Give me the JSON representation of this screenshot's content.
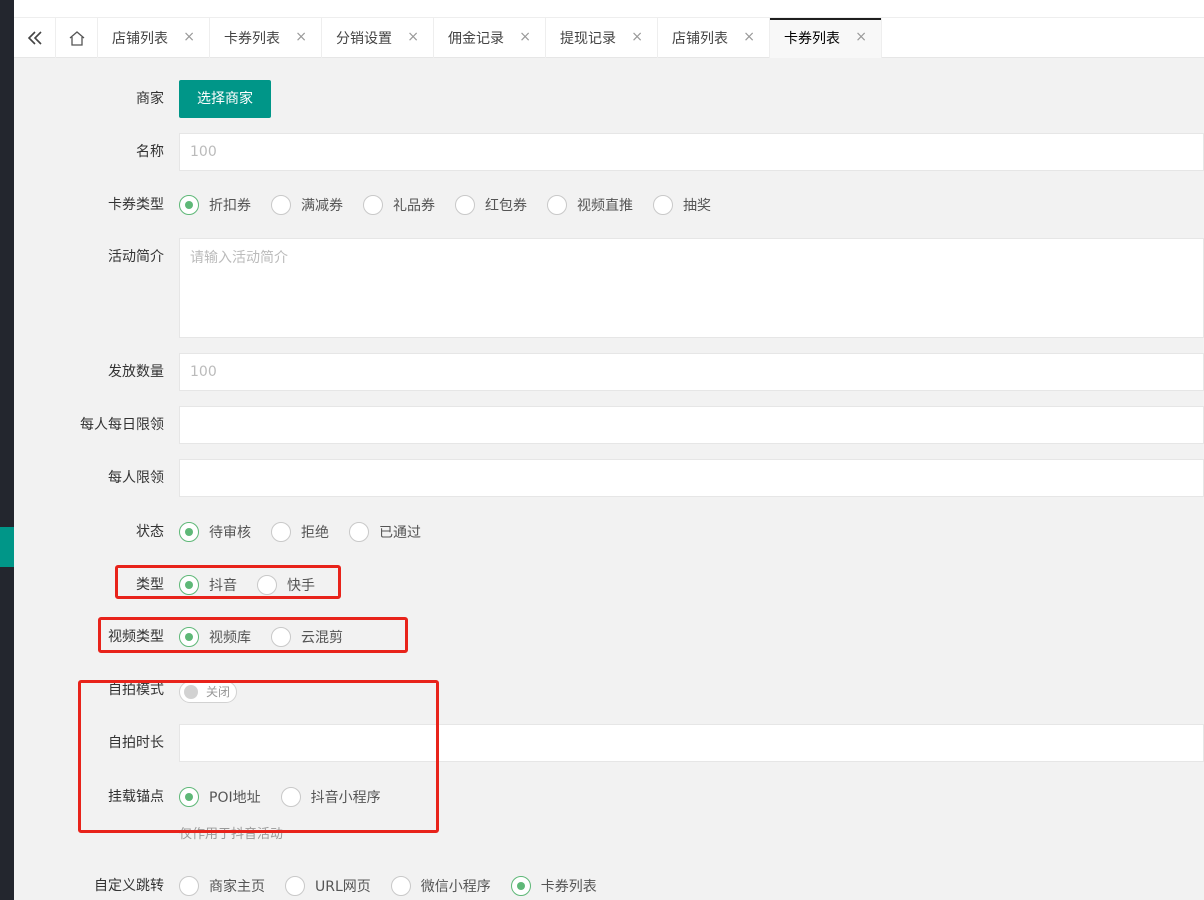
{
  "tabs": {
    "items": [
      {
        "label": "店铺列表"
      },
      {
        "label": "卡券列表"
      },
      {
        "label": "分销设置"
      },
      {
        "label": "佣金记录"
      },
      {
        "label": "提现记录"
      },
      {
        "label": "店铺列表"
      },
      {
        "label": "卡券列表"
      }
    ],
    "active_index": 6,
    "close_glyph": "×"
  },
  "form": {
    "merchant": {
      "label": "商家",
      "button": "选择商家"
    },
    "name": {
      "label": "名称",
      "placeholder": "100"
    },
    "coupon_type": {
      "label": "卡券类型",
      "options": [
        "折扣券",
        "满减券",
        "礼品券",
        "红包券",
        "视频直推",
        "抽奖"
      ],
      "selected": 0
    },
    "intro": {
      "label": "活动简介",
      "placeholder": "请输入活动简介"
    },
    "quantity": {
      "label": "发放数量",
      "placeholder": "100"
    },
    "daily_limit": {
      "label": "每人每日限领",
      "value": ""
    },
    "per_limit": {
      "label": "每人限领",
      "value": ""
    },
    "status": {
      "label": "状态",
      "options": [
        "待审核",
        "拒绝",
        "已通过"
      ],
      "selected": 0
    },
    "type": {
      "label": "类型",
      "options": [
        "抖音",
        "快手"
      ],
      "selected": 0
    },
    "video_type": {
      "label": "视频类型",
      "options": [
        "视频库",
        "云混剪"
      ],
      "selected": 0
    },
    "selfie_mode": {
      "label": "自拍模式",
      "switch_text": "关闭"
    },
    "selfie_duration": {
      "label": "自拍时长",
      "value": ""
    },
    "anchor": {
      "label": "挂载锚点",
      "options": [
        "POI地址",
        "抖音小程序"
      ],
      "selected": 0,
      "hint": "仅作用于抖音活动"
    },
    "custom_jump": {
      "label": "自定义跳转",
      "options": [
        "商家主页",
        "URL网页",
        "微信小程序",
        "卡券列表"
      ],
      "selected": 3
    }
  },
  "colors": {
    "primary": "#009688",
    "radio_checked": "#5fb878",
    "highlight_box": "#e8231b"
  }
}
